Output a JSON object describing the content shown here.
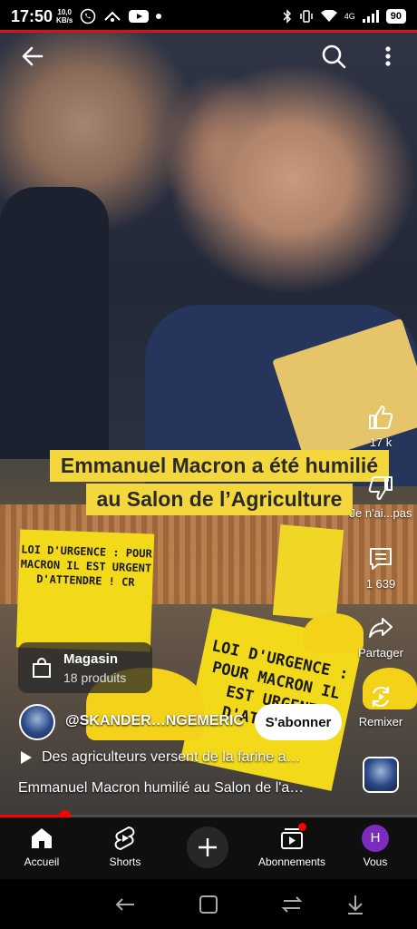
{
  "status_bar": {
    "time": "17:50",
    "speed_value": "10,0",
    "speed_unit": "KB/s",
    "battery": "90",
    "signal": "4G"
  },
  "caption": {
    "line1": "Emmanuel Macron a été humilié",
    "line2": "au Salon de l’Agriculture"
  },
  "signs": {
    "left": "LOI D'URGENCE : POUR MACRON IL EST URGENT D'ATTENDRE ! CR",
    "right": "LOI D'URGENCE : POUR MACRON IL EST URGENT D'ATTENDRE"
  },
  "rail": {
    "like_count": "17 k",
    "dislike_label": "Je n'ai...pas",
    "comments_count": "1 639",
    "share_label": "Partager",
    "remix_label": "Remixer"
  },
  "shop": {
    "title": "Magasin",
    "subtitle": "18 produits"
  },
  "channel": {
    "name": "@SKANDER…NGEMERIC",
    "subscribe_label": "S'abonner"
  },
  "playlist_text": "Des agriculteurs versent de la farine a…",
  "video_title": "Emmanuel Macron humilié au Salon de l'a…",
  "progress": {
    "fraction": 0.156
  },
  "bottom_nav": {
    "home": "Accueil",
    "shorts": "Shorts",
    "subscriptions": "Abonnements",
    "you": "Vous",
    "you_initial": "H"
  },
  "colors": {
    "accent_red": "#ff0000",
    "caption_bg": "#f4d73c",
    "avatar_purple": "#7b2cbf"
  },
  "icons": [
    "back-arrow-icon",
    "search-icon",
    "more-vert-icon",
    "like-icon",
    "dislike-icon",
    "comment-icon",
    "share-icon",
    "remix-icon",
    "shopping-bag-icon",
    "play-icon",
    "home-icon",
    "shorts-icon",
    "plus-icon",
    "subscriptions-icon",
    "system-back-icon",
    "recents-icon",
    "home-square-icon",
    "down-arrow-icon"
  ]
}
